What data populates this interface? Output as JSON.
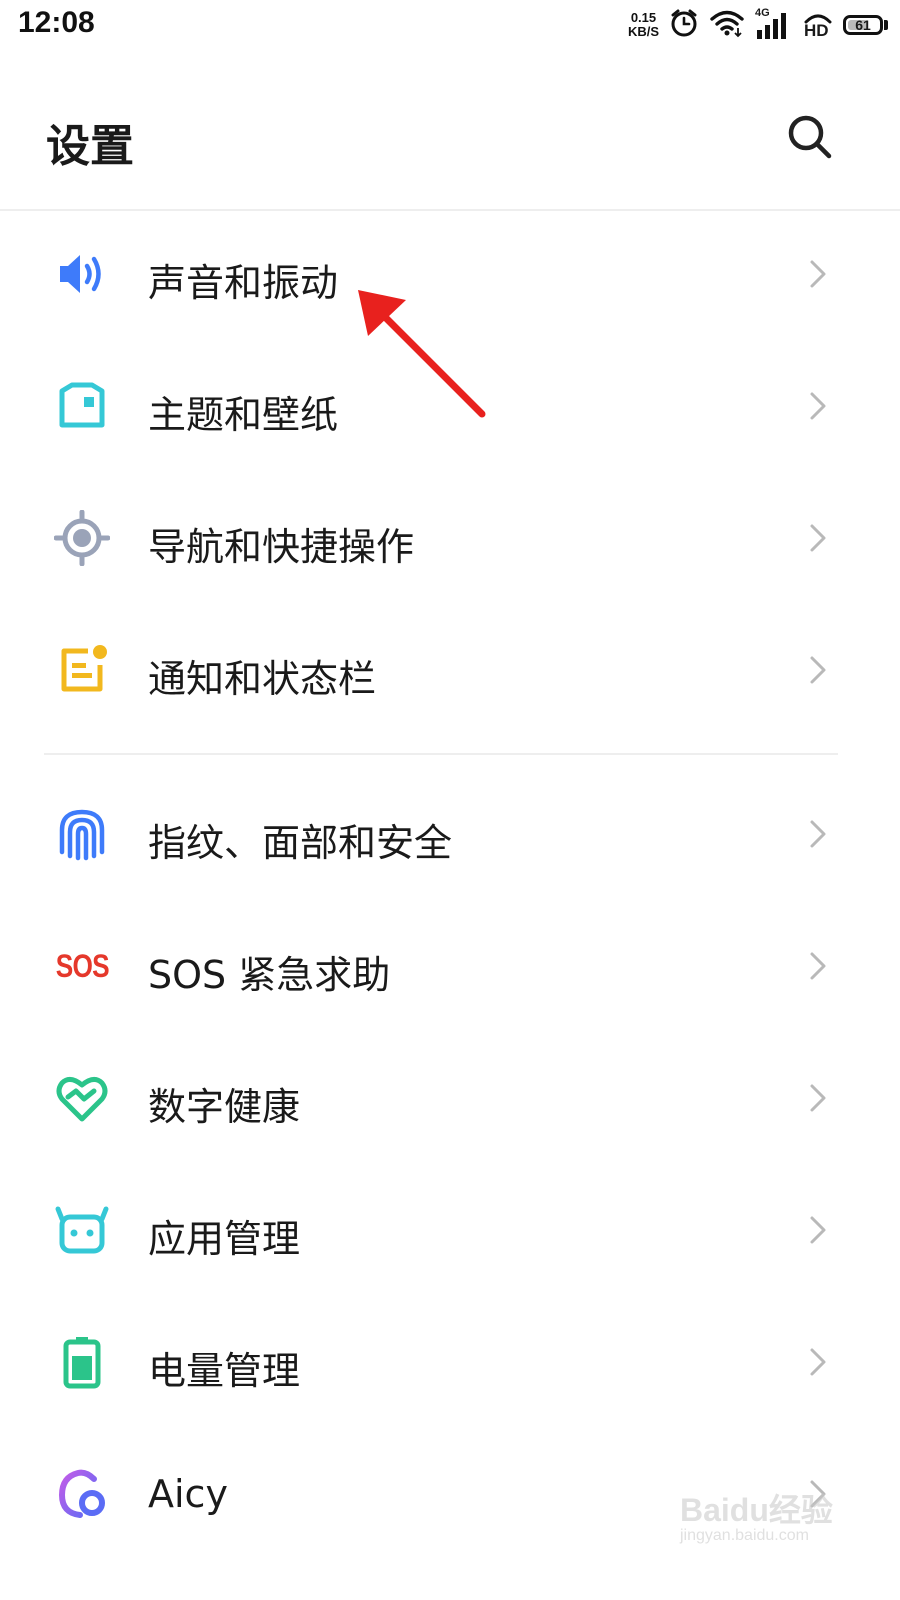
{
  "status_bar": {
    "time": "12:08",
    "net_speed_value": "0.15",
    "net_speed_unit": "KB/S",
    "network_type": "4G",
    "hd_label": "HD",
    "battery_level": "61",
    "icons": [
      "alarm-icon",
      "wifi-icon",
      "signal-icon",
      "hd-voice-icon",
      "battery-icon"
    ]
  },
  "header": {
    "title": "设置",
    "search_icon": "search-icon"
  },
  "settings_items": [
    {
      "label": "声音和振动",
      "icon": "speaker-icon",
      "color": "#3E7BFA"
    },
    {
      "label": "主题和壁纸",
      "icon": "theme-icon",
      "color": "#35C8D6"
    },
    {
      "label": "导航和快捷操作",
      "icon": "navigation-icon",
      "color": "#9AA3B8"
    },
    {
      "label": "通知和状态栏",
      "icon": "notification-icon",
      "color": "#F2B81E"
    },
    {
      "label": "指纹、面部和安全",
      "icon": "fingerprint-icon",
      "color": "#3E7BFA"
    },
    {
      "label": "SOS 紧急求助",
      "icon": "sos-icon",
      "color": "#E5382B"
    },
    {
      "label": "数字健康",
      "icon": "digital-health-icon",
      "color": "#2BC48A"
    },
    {
      "label": "应用管理",
      "icon": "app-management-icon",
      "color": "#35C8D6"
    },
    {
      "label": "电量管理",
      "icon": "battery-management-icon",
      "color": "#2BC48A"
    },
    {
      "label": "Aicy",
      "icon": "aicy-icon",
      "color": "#8A5CF5"
    }
  ],
  "sos_icon_text": "SOS",
  "annotation": {
    "arrow_color": "#E8211E",
    "target": "声音和振动"
  },
  "watermark": {
    "main": "Baidu经验",
    "sub": "jingyan.baidu.com"
  }
}
